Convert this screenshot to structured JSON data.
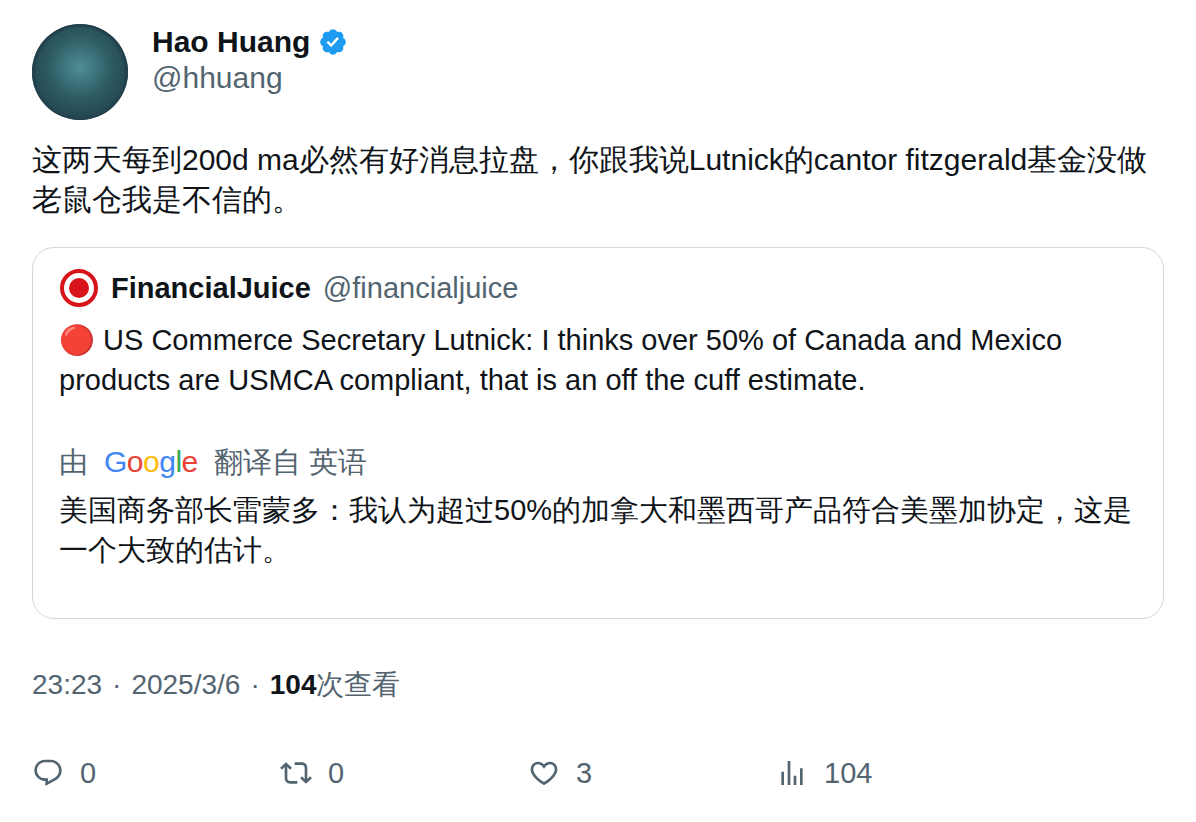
{
  "author": {
    "name": "Hao Huang",
    "handle": "@hhuang",
    "verified": true
  },
  "tweet": {
    "text": "这两天每到200d ma必然有好消息拉盘，你跟我说Lutnick的cantor fitzgerald基金没做老鼠仓我是不信的。"
  },
  "quoted": {
    "name": "FinancialJuice",
    "handle": "@financialjuice",
    "text": "🔴 US Commerce Secretary Lutnick: I thinks over 50% of Canada and Mexico products are USMCA compliant, that is an off the cuff estimate.",
    "translation_label": {
      "prefix": "由",
      "brand": "Google",
      "suffix": "翻译自 英语"
    },
    "translation": "美国商务部长雷蒙多：我认为超过50%的加拿大和墨西哥产品符合美墨加协定，这是一个大致的估计。"
  },
  "meta": {
    "time": "23:23",
    "separator": "·",
    "date": "2025/3/6",
    "views": "104",
    "views_label": "次查看"
  },
  "actions": [
    {
      "kind": "reply",
      "count": "0"
    },
    {
      "kind": "retweet",
      "count": "0"
    },
    {
      "kind": "like",
      "count": "3"
    },
    {
      "kind": "views",
      "count": "104"
    }
  ]
}
